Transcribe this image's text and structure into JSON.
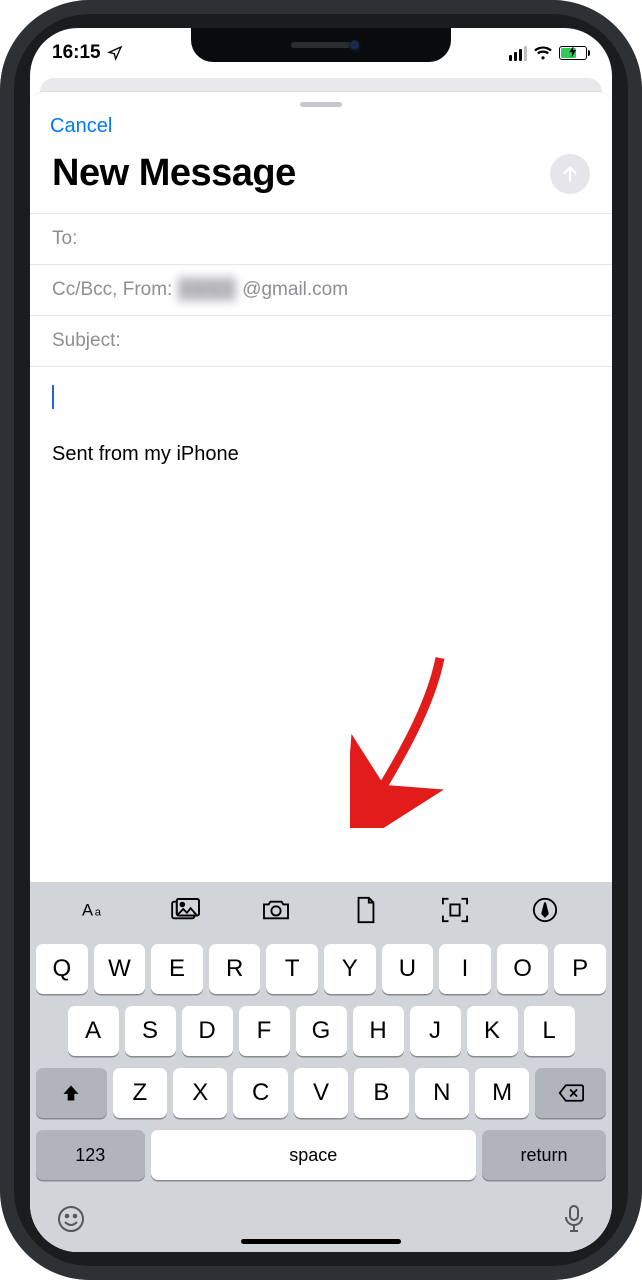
{
  "status": {
    "time": "16:15"
  },
  "sheet": {
    "cancel": "Cancel",
    "title": "New Message",
    "to_label": "To:",
    "ccbcc_from_label": "Cc/Bcc, From:",
    "from_redacted": "████",
    "from_domain": "@gmail.com",
    "subject_label": "Subject:",
    "signature": "Sent from my iPhone"
  },
  "keyboard": {
    "row1": [
      "Q",
      "W",
      "E",
      "R",
      "T",
      "Y",
      "U",
      "I",
      "O",
      "P"
    ],
    "row2": [
      "A",
      "S",
      "D",
      "F",
      "G",
      "H",
      "J",
      "K",
      "L"
    ],
    "row3": [
      "Z",
      "X",
      "C",
      "V",
      "B",
      "N",
      "M"
    ],
    "num": "123",
    "space": "space",
    "return": "return"
  }
}
